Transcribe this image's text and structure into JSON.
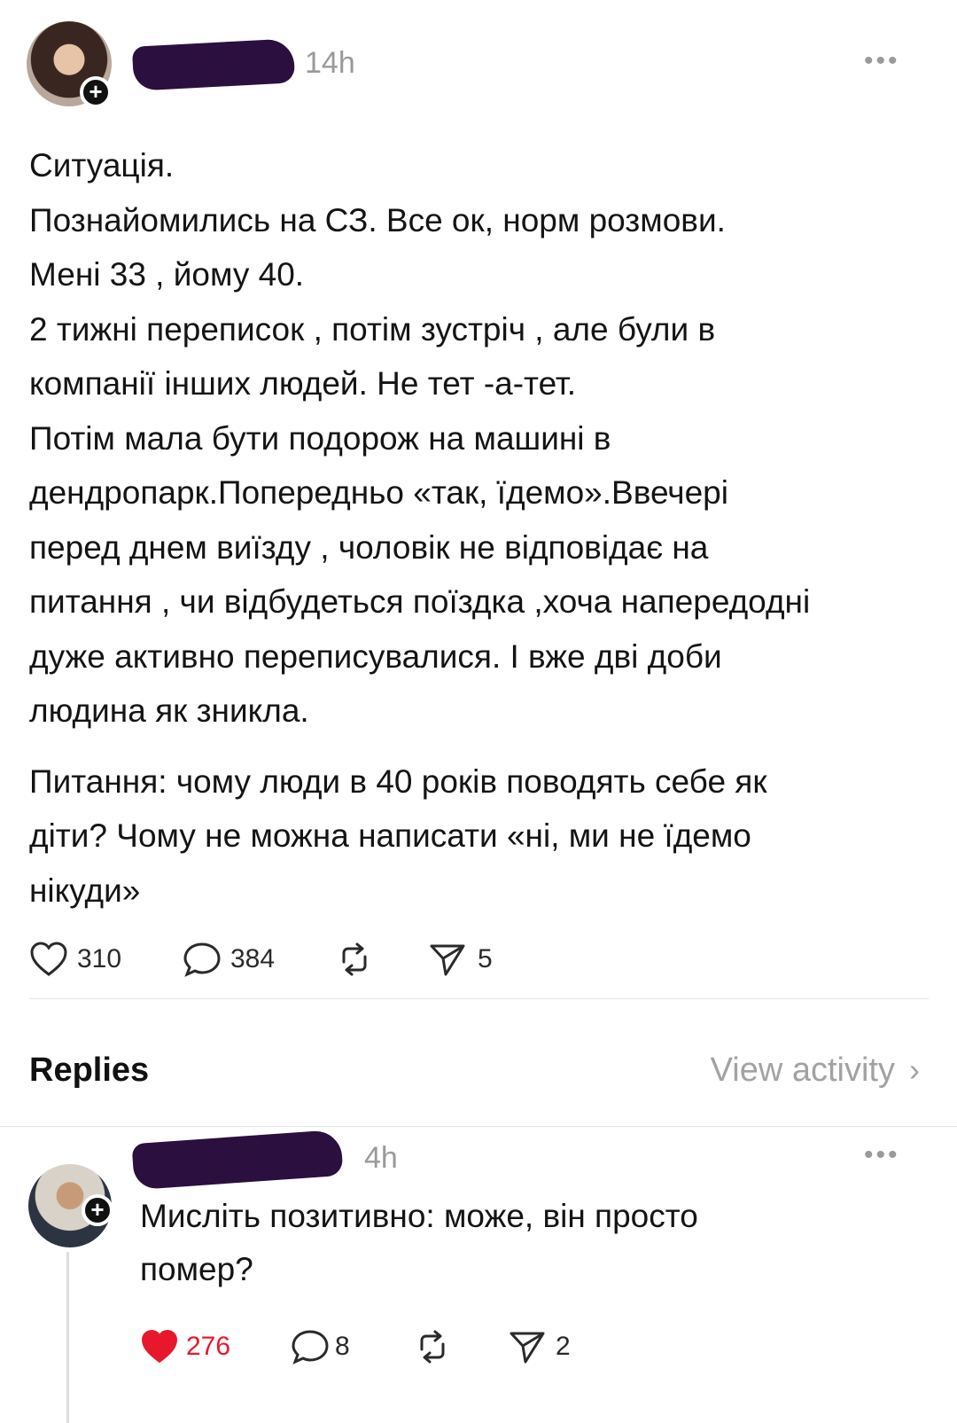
{
  "post": {
    "time": "14h",
    "paragraphs": [
      "Ситуація.",
      "Познайомились на СЗ. Все ок, норм розмови.",
      "Мені 33 , йому 40.",
      "2 тижні переписок , потім зустріч , але були в компанії інших людей. Не тет -а-тет.",
      "Потім мала бути подорож на машині в дендропарк.Попередньо «так, їдемо».Ввечері перед днем виїзду , чоловік не відповідає на питання , чи відбудеться поїздка ,хоча напередодні дуже активно переписувалися. І вже дві доби людина як зникла."
    ],
    "question": "Питання: чому люди в 40 років поводять  себе як діти? Чому не можна написати «ні, ми не їдемо нікуди»",
    "likes": "310",
    "comments": "384",
    "shares": "5"
  },
  "replies_section": {
    "title": "Replies",
    "view_activity": "View activity",
    "chevron": "›"
  },
  "reply": {
    "time": "4h",
    "text": "Мисліть позитивно: може, він просто помер?",
    "likes": "276",
    "comments": "8",
    "shares": "2",
    "like_color": "#e8182c"
  },
  "icons": {
    "more": "more-horizontal-icon",
    "like": "heart-icon",
    "comment": "comment-bubble-icon",
    "repost": "repost-icon",
    "share": "send-icon",
    "follow": "plus-icon"
  }
}
